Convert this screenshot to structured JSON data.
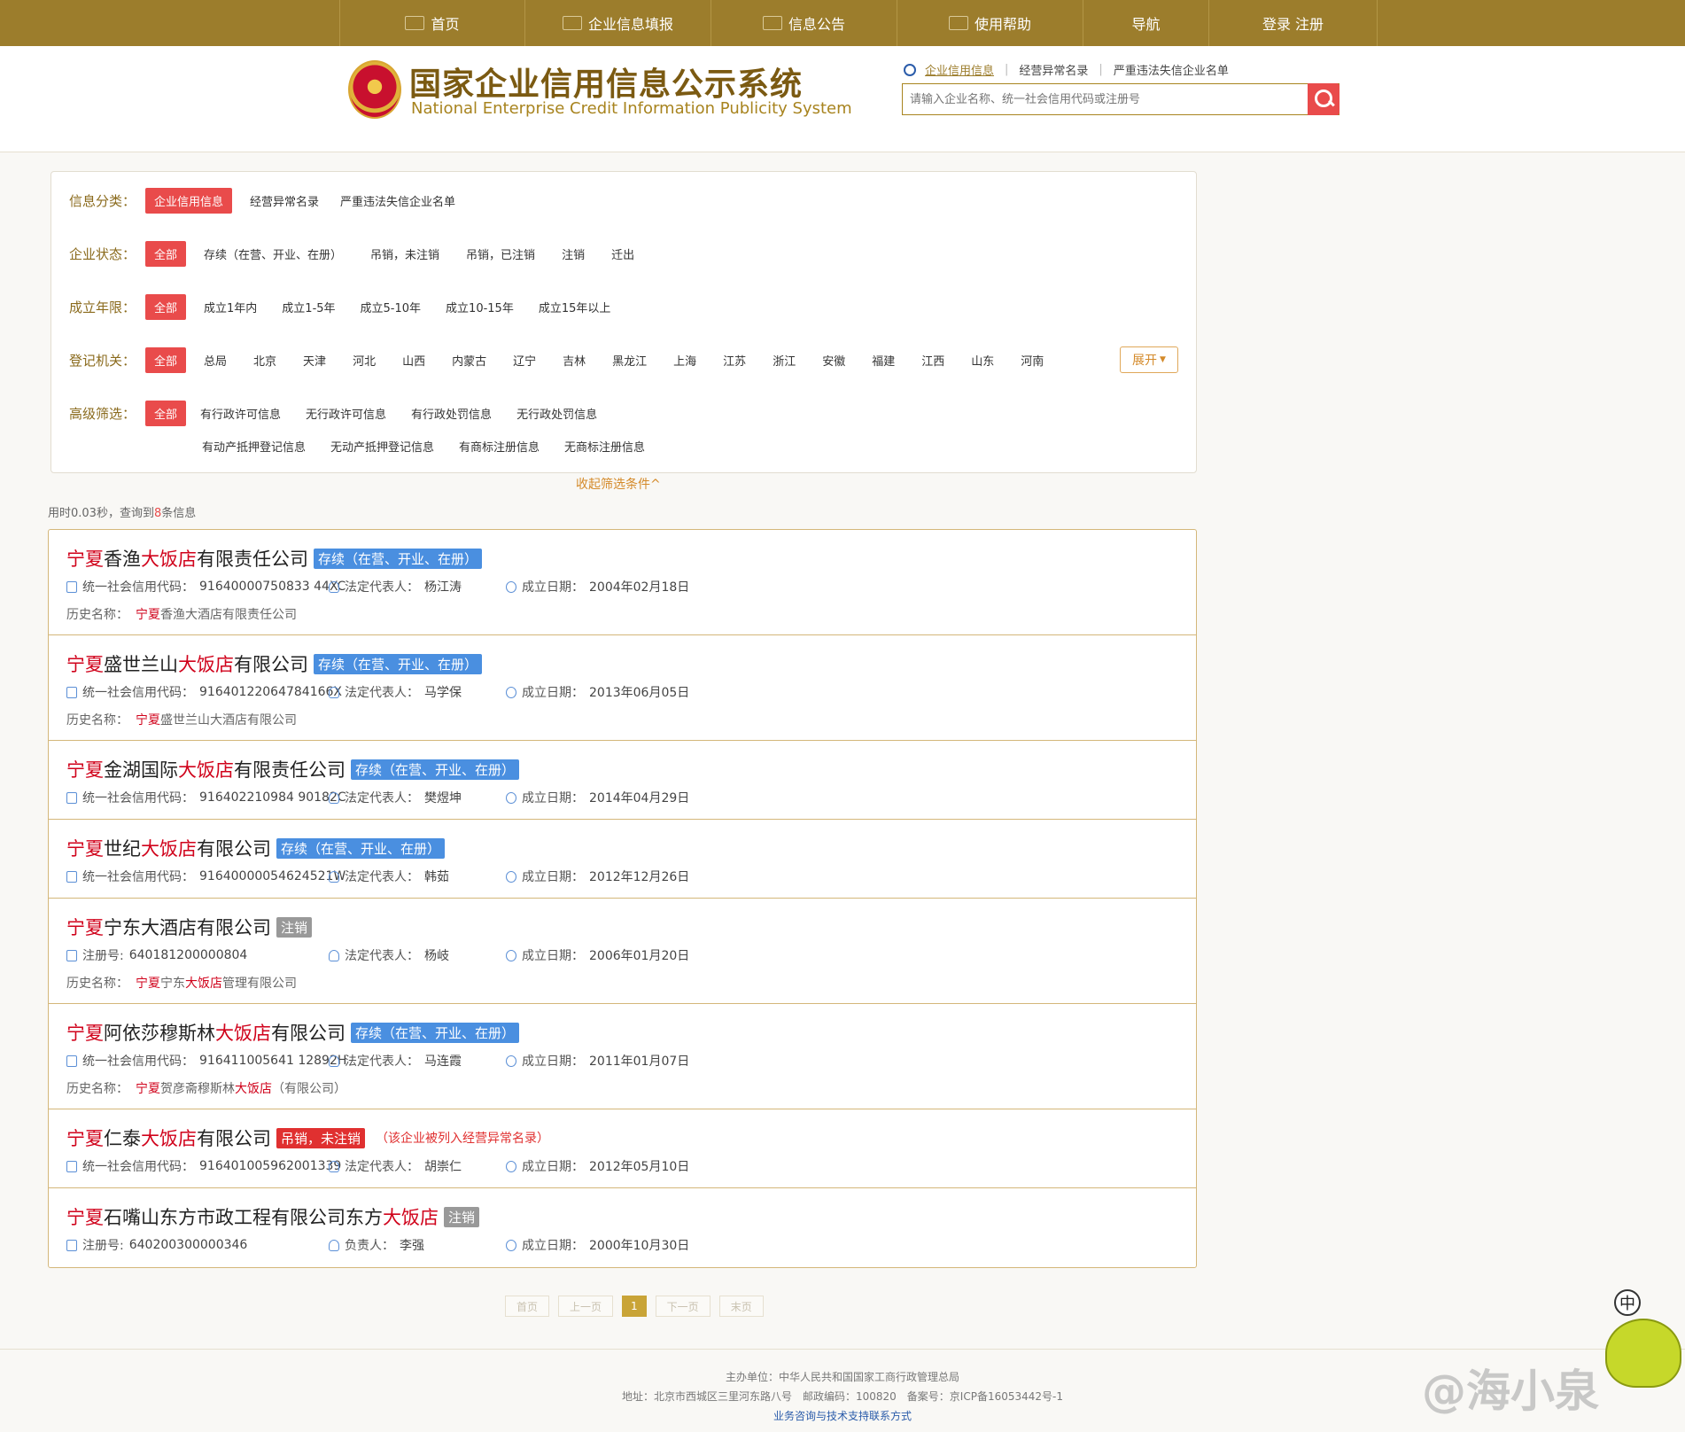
{
  "nav": {
    "items": [
      {
        "label": "首页",
        "icon": "monitor-icon"
      },
      {
        "label": "企业信息填报",
        "icon": "edit-icon"
      },
      {
        "label": "信息公告",
        "icon": "document-icon"
      },
      {
        "label": "使用帮助",
        "icon": "speaker-icon"
      },
      {
        "label": "导航",
        "icon": ""
      },
      {
        "label": "登录 注册",
        "icon": ""
      }
    ]
  },
  "header": {
    "title_cn": "国家企业信用信息公示系统",
    "title_en": "National Enterprise Credit Information Publicity System",
    "search_tabs": [
      "企业信用信息",
      "经营异常名录",
      "严重违法失信企业名单"
    ],
    "search_placeholder": "请输入企业名称、统一社会信用代码或注册号"
  },
  "filters": {
    "category": {
      "label": "信息分类：",
      "options": [
        "企业信用信息",
        "经营异常名录",
        "严重违法失信企业名单"
      ]
    },
    "status": {
      "label": "企业状态：",
      "options": [
        "全部",
        "存续（在营、开业、在册）",
        "吊销，未注销",
        "吊销，已注销",
        "注销",
        "迁出"
      ]
    },
    "age": {
      "label": "成立年限：",
      "options": [
        "全部",
        "成立1年内",
        "成立1-5年",
        "成立5-10年",
        "成立10-15年",
        "成立15年以上"
      ]
    },
    "registry": {
      "label": "登记机关：",
      "options": [
        "全部",
        "总局",
        "北京",
        "天津",
        "河北",
        "山西",
        "内蒙古",
        "辽宁",
        "吉林",
        "黑龙江",
        "上海",
        "江苏",
        "浙江",
        "安徽",
        "福建",
        "江西",
        "山东",
        "河南"
      ],
      "expand": "展开"
    },
    "advanced": {
      "label": "高级筛选：",
      "options": [
        "全部",
        "有行政许可信息",
        "无行政许可信息",
        "有行政处罚信息",
        "无行政处罚信息"
      ],
      "options2": [
        "有动产抵押登记信息",
        "无动产抵押登记信息",
        "有商标注册信息",
        "无商标注册信息"
      ]
    },
    "collapse": "收起筛选条件^"
  },
  "stats": {
    "prefix": "用时0.03秒，查询到",
    "count": "8",
    "suffix": "条信息"
  },
  "labels": {
    "credit_code": "统一社会信用代码：",
    "reg_no": "注册号:",
    "legal_rep": "法定代表人：",
    "responsible": "负责人：",
    "founded": "成立日期：",
    "history": "历史名称："
  },
  "results": [
    {
      "name": [
        [
          "宁夏",
          true
        ],
        [
          "香渔",
          false
        ],
        [
          "大饭店",
          true
        ],
        [
          "有限责任公司",
          false
        ]
      ],
      "status": "存续（在营、开业、在册）",
      "status_color": "#4a8fe0",
      "code_label": "统一社会信用代码：",
      "code": "91640000750833 44XC",
      "rep_label": "法定代表人：",
      "rep": "杨江涛",
      "date": "2004年02月18日",
      "history": [
        [
          "宁夏",
          true
        ],
        [
          "香渔大酒店有限责任公司",
          false
        ]
      ]
    },
    {
      "name": [
        [
          "宁夏",
          true
        ],
        [
          "盛世兰山",
          false
        ],
        [
          "大饭店",
          true
        ],
        [
          "有限公司",
          false
        ]
      ],
      "status": "存续（在营、开业、在册）",
      "status_color": "#4a8fe0",
      "code_label": "统一社会信用代码：",
      "code": "91640122064784166X",
      "rep_label": "法定代表人：",
      "rep": "马学保",
      "date": "2013年06月05日",
      "history": [
        [
          "宁夏",
          true
        ],
        [
          "盛世兰山大酒店有限公司",
          false
        ]
      ]
    },
    {
      "name": [
        [
          "宁夏",
          true
        ],
        [
          "金湖国际",
          false
        ],
        [
          "大饭店",
          true
        ],
        [
          "有限责任公司",
          false
        ]
      ],
      "status": "存续（在营、开业、在册）",
      "status_color": "#4a8fe0",
      "code_label": "统一社会信用代码：",
      "code": "916402210984 90182C",
      "rep_label": "法定代表人：",
      "rep": "樊煜坤",
      "date": "2014年04月29日",
      "history": null
    },
    {
      "name": [
        [
          "宁夏",
          true
        ],
        [
          "世纪",
          false
        ],
        [
          "大饭店",
          true
        ],
        [
          "有限公司",
          false
        ]
      ],
      "status": "存续（在营、开业、在册）",
      "status_color": "#4a8fe0",
      "code_label": "统一社会信用代码：",
      "code": "91640000054624521W",
      "rep_label": "法定代表人：",
      "rep": "韩茹",
      "date": "2012年12月26日",
      "history": null
    },
    {
      "name": [
        [
          "宁夏",
          true
        ],
        [
          "宁东大酒店有限公司",
          false
        ]
      ],
      "status": "注销",
      "status_color": "#999999",
      "code_label": "注册号:",
      "code": "640181200000804",
      "rep_label": "法定代表人：",
      "rep": "杨岐",
      "date": "2006年01月20日",
      "history": [
        [
          "宁夏",
          true
        ],
        [
          "宁东",
          false
        ],
        [
          "大饭店",
          true
        ],
        [
          "管理有限公司",
          false
        ]
      ]
    },
    {
      "name": [
        [
          "宁夏",
          true
        ],
        [
          "阿依莎穆斯林",
          false
        ],
        [
          "大饭店",
          true
        ],
        [
          "有限公司",
          false
        ]
      ],
      "status": "存续（在营、开业、在册）",
      "status_color": "#4a8fe0",
      "code_label": "统一社会信用代码：",
      "code": "916411005641 12892H",
      "rep_label": "法定代表人：",
      "rep": "马连霞",
      "date": "2011年01月07日",
      "history": [
        [
          "宁夏",
          true
        ],
        [
          "贺彦斋穆斯林",
          false
        ],
        [
          "大饭店",
          true
        ],
        [
          "（有限公司）",
          false
        ]
      ]
    },
    {
      "name": [
        [
          "宁夏",
          true
        ],
        [
          "仁泰",
          false
        ],
        [
          "大饭店",
          true
        ],
        [
          "有限公司",
          false
        ]
      ],
      "status": "吊销，未注销",
      "status_color": "#e03030",
      "warning": "（该企业被列入经营异常名录）",
      "code_label": "统一社会信用代码：",
      "code": "916401005962001339",
      "rep_label": "法定代表人：",
      "rep": "胡崇仁",
      "date": "2012年05月10日",
      "history": null
    },
    {
      "name": [
        [
          "宁夏",
          true
        ],
        [
          "石嘴山东方市政工程有限公司东方",
          false
        ],
        [
          "大饭店",
          true
        ]
      ],
      "status": "注销",
      "status_color": "#999999",
      "code_label": "注册号:",
      "code": "640200300000346",
      "rep_label": "负责人：",
      "rep": "李强",
      "date": "2000年10月30日",
      "history": null
    }
  ],
  "pager": {
    "first": "首页",
    "prev": "上一页",
    "current": "1",
    "next": "下一页",
    "last": "末页"
  },
  "footer": {
    "sponsor": "主办单位：中华人民共和国国家工商行政管理总局",
    "address": "地址：北京市西城区三里河东路八号　邮政编码：100820　备案号：京ICP备16053442号-1",
    "contact": "业务咨询与技术支持联系方式"
  },
  "watermark": "@海小泉",
  "mascot_char": "中"
}
